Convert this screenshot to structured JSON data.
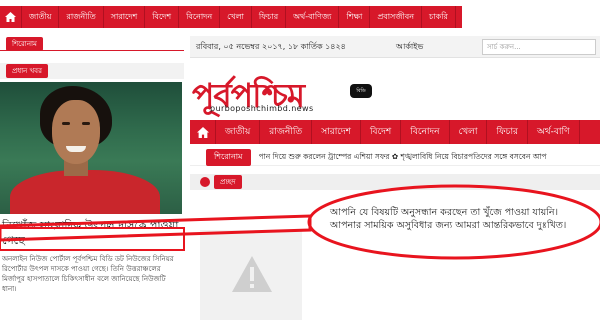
{
  "top_nav": {
    "home_icon": "home-icon",
    "items": [
      "জাতীয়",
      "রাজনীতি",
      "সারাদেশ",
      "বিদেশ",
      "বিনোদন",
      "খেলা",
      "ফিচার",
      "অর্থ-বাণিজ্য",
      "শিক্ষা",
      "প্রবাসজীবন",
      "চাকরি"
    ]
  },
  "left": {
    "section_1": "শিরোনাম",
    "section_2": "প্রধান খবর",
    "headline": "নিখোঁজ সাংবাদিক উৎপল দাসকে পাওয়া গেছে",
    "summary": "অনলাইন নিউজ পোর্টাল পূর্বপশ্চিম বিডি ডট নিউজের সিনিয়র রিপোর্টার উৎপল দাসকে পাওয়া গেছে। তিনি উত্তরাঞ্চলের মির্জাপুর হাসপাতালে চিকিৎসাধীন বলে জানিয়েছে নিউজটি ধানা।"
  },
  "right": {
    "date": "রবিবার, ০৫ নভেম্বর ২০১৭, ১৮ কার্তিক ১৪২৪",
    "archive": "আর্কাইভ",
    "search_placeholder": "সার্চ করুন...",
    "logo_text": "পূর্বপশ্চিম",
    "logo_badge": "বিডি নিউজ",
    "logo_url": "purboposhchimbd.news",
    "nav_items": [
      "জাতীয়",
      "রাজনীতি",
      "সারাদেশ",
      "বিদেশ",
      "বিনোদন",
      "খেলা",
      "ফিচার",
      "অর্থ-বাণি"
    ],
    "ticker_tag": "শিরোনাম",
    "ticker_text": "পান দিয়ে শুরু করলেন ট্রাম্পের এশিয়া সফর  ✿ শৃঙ্খলাবিধি নিয়ে বিচারপতিদের সঙ্গে বসবেন আপ",
    "crumb": "প্রচ্ছদ",
    "not_found_line1": "আপনি যে বিষয়টি অনুসন্ধান করছেন তা খুঁজে পাওয়া যায়নি।",
    "not_found_line2": "আপনার সাময়িক অসুবিধার জন্য আমরা আন্তরিকভাবে দুঃখিত।"
  },
  "colors": {
    "brand_red": "#d7182a",
    "annotation_red": "#e8141e"
  }
}
